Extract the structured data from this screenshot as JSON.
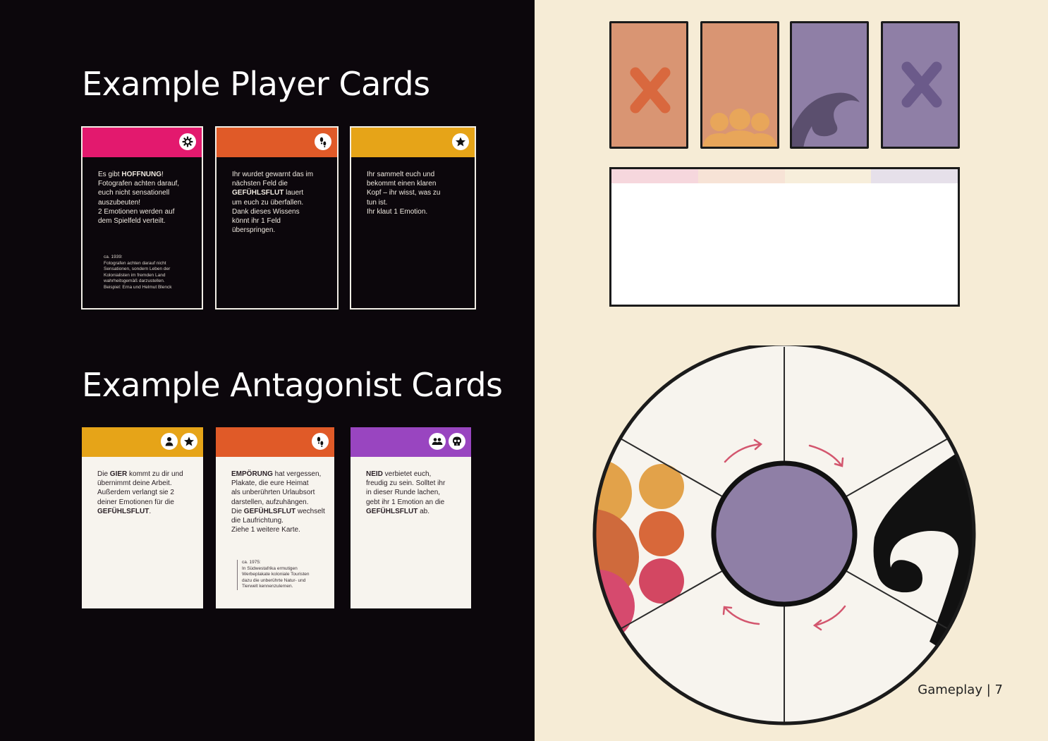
{
  "headings": {
    "player": "Example Player Cards",
    "antagonist": "Example Antagonist Cards"
  },
  "player_cards": [
    {
      "color": "#e3196e",
      "icons": [
        "gear-icon"
      ],
      "lines": [
        [
          {
            "t": "Es gibt "
          },
          {
            "t": "HOFFNUNG",
            "b": true
          },
          {
            "t": "!"
          }
        ],
        [
          {
            "t": "Fotografen achten darauf,"
          }
        ],
        [
          {
            "t": "euch nicht sensationell"
          }
        ],
        [
          {
            "t": "auszubeuten!"
          }
        ],
        [
          {
            "t": "2 Emotionen werden auf"
          }
        ],
        [
          {
            "t": "dem Spielfeld verteilt."
          }
        ]
      ],
      "note": [
        "ca. 1939:",
        "Fotografen achten darauf nicht",
        "Sensationen, sondern Leben der",
        "Kolonialisten im fremden Land",
        "wahrheitsgemäß darzustellen.",
        "Beispiel: Erna und Helmut Blenck"
      ]
    },
    {
      "color": "#e05a28",
      "icons": [
        "footprints-icon"
      ],
      "lines": [
        [
          {
            "t": "Ihr wurdet gewarnt das im"
          }
        ],
        [
          {
            "t": "nächsten Feld die"
          }
        ],
        [
          {
            "t": "GEFÜHLSFLUT",
            "b": true
          },
          {
            "t": " lauert"
          }
        ],
        [
          {
            "t": "um euch zu überfallen."
          }
        ],
        [
          {
            "t": "Dank dieses Wissens"
          }
        ],
        [
          {
            "t": "könnt ihr 1 Feld"
          }
        ],
        [
          {
            "t": "überspringen."
          }
        ]
      ],
      "note": []
    },
    {
      "color": "#e6a418",
      "icons": [
        "star-icon"
      ],
      "lines": [
        [
          {
            "t": "Ihr sammelt euch und"
          }
        ],
        [
          {
            "t": "bekommt einen klaren"
          }
        ],
        [
          {
            "t": "Kopf – ihr wisst, was zu"
          }
        ],
        [
          {
            "t": "tun ist."
          }
        ],
        [
          {
            "t": "Ihr klaut 1 Emotion."
          }
        ]
      ],
      "note": []
    }
  ],
  "antagonist_cards": [
    {
      "color": "#e6a418",
      "icons": [
        "person-icon",
        "star-icon"
      ],
      "lines": [
        [
          {
            "t": "Die "
          },
          {
            "t": "GIER",
            "b": true
          },
          {
            "t": " kommt zu dir und"
          }
        ],
        [
          {
            "t": "übernimmt deine Arbeit."
          }
        ],
        [
          {
            "t": "Außerdem verlangt sie 2"
          }
        ],
        [
          {
            "t": "deiner Emotionen für die"
          }
        ],
        [
          {
            "t": "GEFÜHLSFLUT",
            "b": true
          },
          {
            "t": "."
          }
        ]
      ],
      "note": []
    },
    {
      "color": "#e05a28",
      "icons": [
        "footprints-icon"
      ],
      "lines": [
        [
          {
            "t": "EMPÖRUNG",
            "b": true
          },
          {
            "t": " hat vergessen,"
          }
        ],
        [
          {
            "t": "Plakate, die eure Heimat"
          }
        ],
        [
          {
            "t": "als unberührten Urlaubsort"
          }
        ],
        [
          {
            "t": "darstellen, aufzuhängen."
          }
        ],
        [
          {
            "t": "Die "
          },
          {
            "t": "GEFÜHLSFLUT",
            "b": true
          },
          {
            "t": " wechselt"
          }
        ],
        [
          {
            "t": "die Laufrichtung."
          }
        ],
        [
          {
            "t": "Ziehe 1 weitere Karte."
          }
        ]
      ],
      "note": [
        "ca. 1975:",
        "In Südwestafrika ermutigen",
        "Werbeplakate koloniale Touristen",
        "dazu die unberührte Natur- und",
        "Tierwelt kennenzulernen."
      ]
    },
    {
      "color": "#9945c0",
      "icons": [
        "group-icon",
        "skull-icon"
      ],
      "lines": [
        [
          {
            "t": "NEID",
            "b": true
          },
          {
            "t": " verbietet euch,"
          }
        ],
        [
          {
            "t": "freudig zu sein. Solltet ihr"
          }
        ],
        [
          {
            "t": "in dieser Runde lachen,"
          }
        ],
        [
          {
            "t": "gebt ihr 1 Emotion an die"
          }
        ],
        [
          {
            "t": "GEFÜHLSFLUT",
            "b": true
          },
          {
            "t": " ab."
          }
        ]
      ],
      "note": []
    }
  ],
  "board": {
    "card_slots": [
      {
        "color": "#d99573",
        "symbol": "x-icon",
        "symbol_color": "#d9683e"
      },
      {
        "color": "#d99573",
        "symbol": "crowd-icon",
        "symbol_color": "#e8a65a"
      },
      {
        "color": "#8f7fa6",
        "symbol": "wave-icon",
        "symbol_color": "#5b4f6e"
      },
      {
        "color": "#8f7fa6",
        "symbol": "x-icon",
        "symbol_color": "#6b5a8a"
      }
    ],
    "center_color": "#8f7fa6",
    "arrow_color": "#d3566e"
  },
  "footer": {
    "section": "Gameplay",
    "separator": "|",
    "page": "7"
  }
}
